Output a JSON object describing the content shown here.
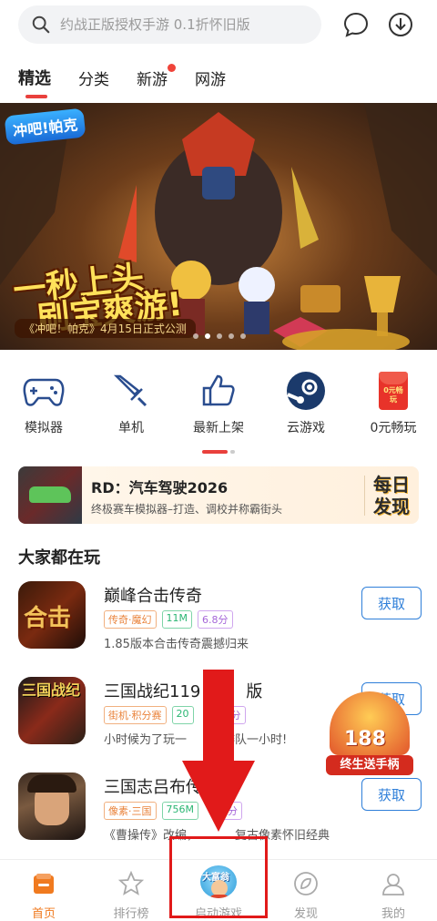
{
  "search": {
    "placeholder": "约战正版授权手游 0.1折怀旧版"
  },
  "header_icons": [
    "message-icon",
    "download-icon"
  ],
  "tabs": [
    {
      "label": "精选",
      "active": true,
      "badge": false
    },
    {
      "label": "分类",
      "active": false,
      "badge": false
    },
    {
      "label": "新游",
      "active": false,
      "badge": true
    },
    {
      "label": "网游",
      "active": false,
      "badge": false
    }
  ],
  "banner": {
    "logo_text": "冲吧!帕克",
    "slogan_line1": "一秒上头",
    "slogan_line2": "刷宝爽游!",
    "date_text": "《冲吧！帕克》4月15日正式公测",
    "dots": 5,
    "active_dot": 1
  },
  "quick_links": [
    {
      "label": "模拟器",
      "icon": "gamepad-icon"
    },
    {
      "label": "单机",
      "icon": "sword-icon"
    },
    {
      "label": "最新上架",
      "icon": "thumbs-up-icon"
    },
    {
      "label": "云游戏",
      "icon": "steam-icon"
    },
    {
      "label": "0元畅玩",
      "icon": "red-envelope-icon",
      "icon_text": "0元畅玩"
    }
  ],
  "promo": {
    "title": "RD：汽车驾驶2026",
    "subtitle": "终极赛车模拟器–打造、调校并称霸街头",
    "badge_line1": "每日",
    "badge_line2": "发现"
  },
  "section": {
    "title": "大家都在玩"
  },
  "games": [
    {
      "name": "巅峰合击传奇",
      "tags": [
        {
          "text": "传奇·魔幻",
          "color": "orange"
        },
        {
          "text": "11M",
          "color": "green"
        },
        {
          "text": "6.8分",
          "color": "purple"
        }
      ],
      "desc": "1.85版本合击传奇震撼归来",
      "action": "获取",
      "icon_text": "合击"
    },
    {
      "name": "三国战纪119",
      "name_suffix": "版",
      "tags": [
        {
          "text": "街机·积分赛",
          "color": "orange"
        },
        {
          "text": "20",
          "color": "green"
        },
        {
          "text": "分",
          "color": "purple"
        }
      ],
      "desc": "小时候为了玩一",
      "desc_suffix": "排队一小时!",
      "action": "获取",
      "icon_text": "三国战纪"
    },
    {
      "name": "三国志吕布传",
      "tags": [
        {
          "text": "像素·三国",
          "color": "orange"
        },
        {
          "text": "756M",
          "color": "green"
        },
        {
          "text": "8分",
          "color": "purple"
        }
      ],
      "desc": "《曹操传》改编，",
      "desc_suffix": "复古像素怀旧经典",
      "action": "获取"
    }
  ],
  "float_ad": {
    "number": "188",
    "caption": "终生送手柄"
  },
  "bottom_nav": [
    {
      "label": "首页",
      "icon": "home-icon",
      "active": true
    },
    {
      "label": "排行榜",
      "icon": "star-icon",
      "active": false
    },
    {
      "label": "启动游戏",
      "icon": "game-avatar-icon",
      "active": false,
      "avatar_text": "大富翁"
    },
    {
      "label": "发现",
      "icon": "compass-icon",
      "active": false
    },
    {
      "label": "我的",
      "icon": "user-icon",
      "active": false
    }
  ],
  "colors": {
    "accent_red": "#e9403c",
    "nav_active": "#f07a1f",
    "button_blue": "#2f7fd9"
  }
}
